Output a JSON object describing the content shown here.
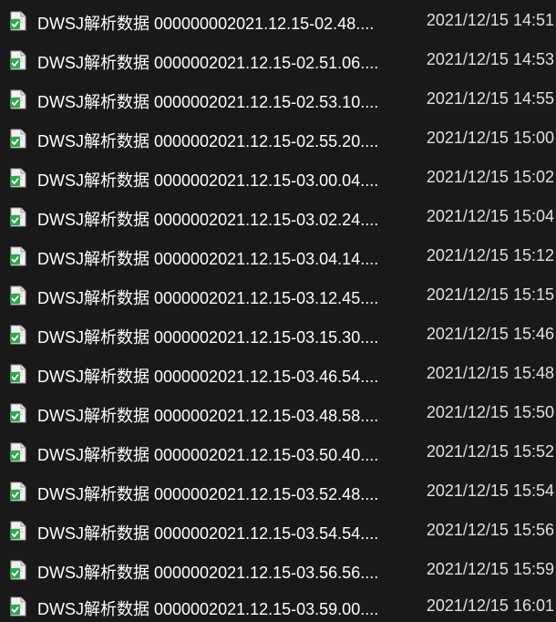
{
  "colors": {
    "background": "#191919",
    "name_text": "#ffffff",
    "date_text": "#e0e0e0",
    "icon_green": "#2ea84a"
  },
  "icon_name": "excel-file-icon",
  "files": [
    {
      "name": "DWSJ解析数据 000000002021.12.15-02.48....",
      "modified": "2021/12/15 14:51"
    },
    {
      "name": "DWSJ解析数据 0000002021.12.15-02.51.06....",
      "modified": "2021/12/15 14:53"
    },
    {
      "name": "DWSJ解析数据 0000002021.12.15-02.53.10....",
      "modified": "2021/12/15 14:55"
    },
    {
      "name": "DWSJ解析数据 0000002021.12.15-02.55.20....",
      "modified": "2021/12/15 15:00"
    },
    {
      "name": "DWSJ解析数据 0000002021.12.15-03.00.04....",
      "modified": "2021/12/15 15:02"
    },
    {
      "name": "DWSJ解析数据 0000002021.12.15-03.02.24....",
      "modified": "2021/12/15 15:04"
    },
    {
      "name": "DWSJ解析数据 0000002021.12.15-03.04.14....",
      "modified": "2021/12/15 15:12"
    },
    {
      "name": "DWSJ解析数据 0000002021.12.15-03.12.45....",
      "modified": "2021/12/15 15:15"
    },
    {
      "name": "DWSJ解析数据 0000002021.12.15-03.15.30....",
      "modified": "2021/12/15 15:46"
    },
    {
      "name": "DWSJ解析数据 0000002021.12.15-03.46.54....",
      "modified": "2021/12/15 15:48"
    },
    {
      "name": "DWSJ解析数据 0000002021.12.15-03.48.58....",
      "modified": "2021/12/15 15:50"
    },
    {
      "name": "DWSJ解析数据 0000002021.12.15-03.50.40....",
      "modified": "2021/12/15 15:52"
    },
    {
      "name": "DWSJ解析数据 0000002021.12.15-03.52.48....",
      "modified": "2021/12/15 15:54"
    },
    {
      "name": "DWSJ解析数据 0000002021.12.15-03.54.54....",
      "modified": "2021/12/15 15:56"
    },
    {
      "name": "DWSJ解析数据 0000002021.12.15-03.56.56....",
      "modified": "2021/12/15 15:59"
    },
    {
      "name": "DWSJ解析数据 0000002021.12.15-03.59.00....",
      "modified": "2021/12/15 16:01"
    }
  ]
}
